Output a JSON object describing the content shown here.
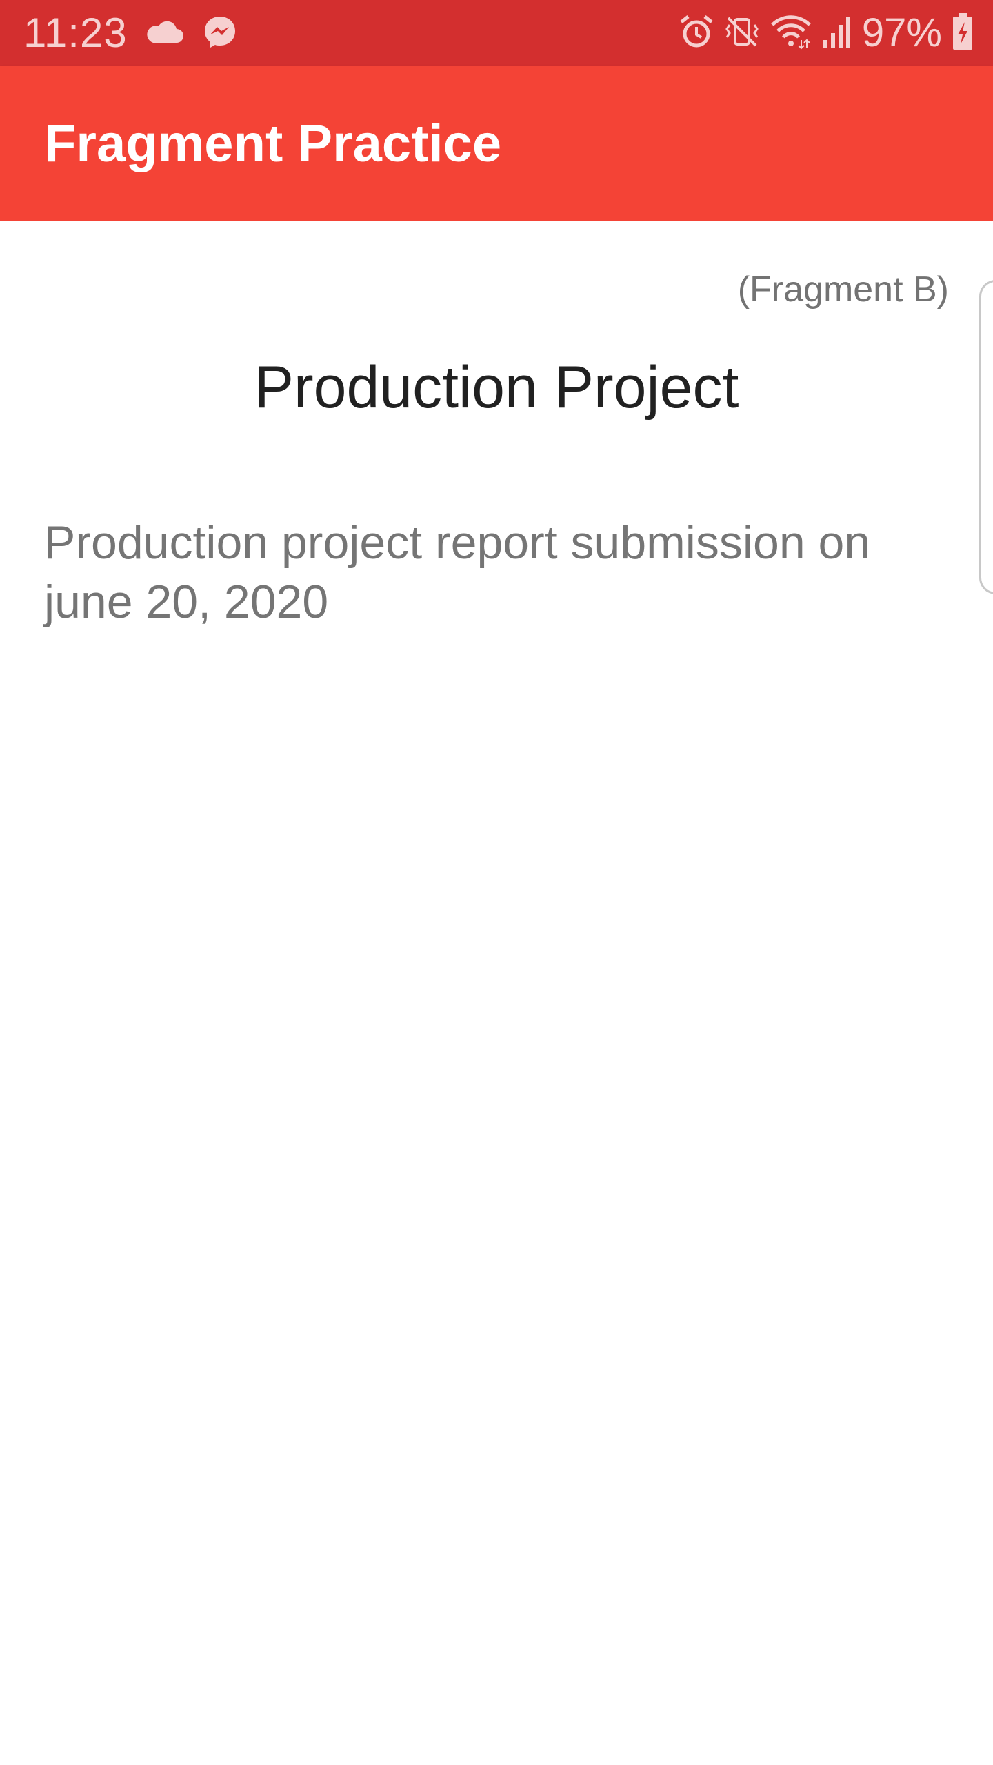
{
  "status_bar": {
    "time": "11:23",
    "battery_percent": "97%",
    "left_icons": [
      "cloud-icon",
      "messenger-icon"
    ],
    "right_icons": [
      "alarm-icon",
      "vibrate-mute-icon",
      "wifi-icon",
      "signal-icon",
      "battery-charging-icon"
    ],
    "background_color": "#d32f2f"
  },
  "app_bar": {
    "title": "Fragment Practice",
    "background_color": "#f44336"
  },
  "fragment": {
    "label": "(Fragment B)",
    "title": "Production Project",
    "description": "Production project report submission on june 20, 2020"
  }
}
